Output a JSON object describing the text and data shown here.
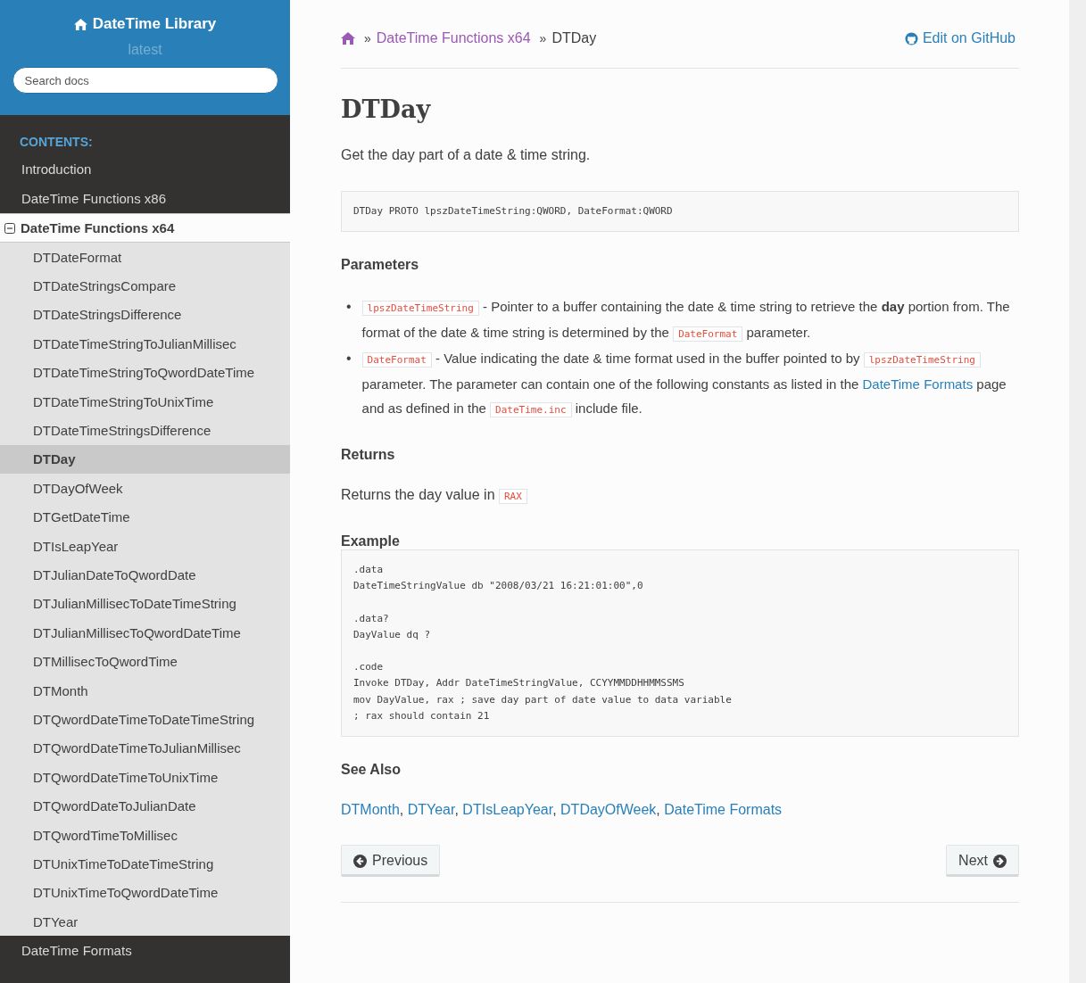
{
  "sidebar": {
    "title": "DateTime Library",
    "version": "latest",
    "search": {
      "placeholder": "Search docs"
    },
    "caption": "CONTENTS:",
    "items": [
      {
        "label": "Introduction",
        "selected": false
      },
      {
        "label": "DateTime Functions x86",
        "selected": false
      },
      {
        "label": "DateTime Functions x64",
        "selected": true,
        "expanded": true,
        "children": [
          {
            "label": "DTDateFormat",
            "selected": false
          },
          {
            "label": "DTDateStringsCompare",
            "selected": false
          },
          {
            "label": "DTDateStringsDifference",
            "selected": false
          },
          {
            "label": "DTDateTimeStringToJulianMillisec",
            "selected": false
          },
          {
            "label": "DTDateTimeStringToQwordDateTime",
            "selected": false
          },
          {
            "label": "DTDateTimeStringToUnixTime",
            "selected": false
          },
          {
            "label": "DTDateTimeStringsDifference",
            "selected": false
          },
          {
            "label": "DTDay",
            "selected": true
          },
          {
            "label": "DTDayOfWeek",
            "selected": false
          },
          {
            "label": "DTGetDateTime",
            "selected": false
          },
          {
            "label": "DTIsLeapYear",
            "selected": false
          },
          {
            "label": "DTJulianDateToQwordDate",
            "selected": false
          },
          {
            "label": "DTJulianMillisecToDateTimeString",
            "selected": false
          },
          {
            "label": "DTJulianMillisecToQwordDateTime",
            "selected": false
          },
          {
            "label": "DTMillisecToQwordTime",
            "selected": false
          },
          {
            "label": "DTMonth",
            "selected": false
          },
          {
            "label": "DTQwordDateTimeToDateTimeString",
            "selected": false
          },
          {
            "label": "DTQwordDateTimeToJulianMillisec",
            "selected": false
          },
          {
            "label": "DTQwordDateTimeToUnixTime",
            "selected": false
          },
          {
            "label": "DTQwordDateToJulianDate",
            "selected": false
          },
          {
            "label": "DTQwordTimeToMillisec",
            "selected": false
          },
          {
            "label": "DTUnixTimeToDateTimeString",
            "selected": false
          },
          {
            "label": "DTUnixTimeToQwordDateTime",
            "selected": false
          },
          {
            "label": "DTYear",
            "selected": false
          }
        ]
      },
      {
        "label": "DateTime Formats",
        "selected": false
      }
    ]
  },
  "breadcrumb": [
    {
      "kind": "home"
    },
    {
      "kind": "link",
      "sep": "»",
      "label": "DateTime Functions x64"
    },
    {
      "kind": "current",
      "sep": "»",
      "label": "DTDay"
    }
  ],
  "edit_link": "Edit on GitHub",
  "title": "DTDay",
  "intro": "Get the day part of a date & time string.",
  "signature": "DTDay PROTO lpszDateTimeString:QWORD, DateFormat:QWORD",
  "sections": [
    {
      "kind": "bullets",
      "heading": "Parameters",
      "items": [
        {
          "marker": "•",
          "segments": [
            {
              "kind": "code",
              "text": "lpszDateTimeString"
            },
            {
              "kind": "text",
              "text": " - Pointer to a buffer containing the date & time string to retrieve the **day** portion from. The format of the date & time string is determined by the "
            },
            {
              "kind": "code",
              "text": "DateFormat"
            },
            {
              "kind": "text",
              "text": " parameter."
            }
          ]
        },
        {
          "marker": "•",
          "segments": [
            {
              "kind": "code",
              "text": "DateFormat"
            },
            {
              "kind": "text",
              "text": " - Value indicating the date & time format used in the buffer pointed to by "
            },
            {
              "kind": "code",
              "text": "lpszDateTimeString"
            },
            {
              "kind": "text",
              "text": " parameter. The parameter can contain one of the following constants as listed in the "
            },
            {
              "kind": "link",
              "text": "DateTime Formats"
            },
            {
              "kind": "text",
              "text": " page and as defined in the "
            },
            {
              "kind": "code",
              "text": "DateTime.inc"
            },
            {
              "kind": "text",
              "text": " include file."
            }
          ]
        }
      ]
    },
    {
      "kind": "paragraph",
      "heading": "Returns",
      "segments": [
        {
          "kind": "text",
          "text": "Returns the day value in "
        },
        {
          "kind": "code",
          "text": "RAX"
        }
      ]
    },
    {
      "kind": "code",
      "heading": "Example",
      "blocks": [
        [
          ".data",
          "DateTimeStringValue db \"2008/03/21 16:21:01:00\",0"
        ],
        [
          ".data?",
          "DayValue dq ?"
        ],
        [
          ".code",
          "Invoke DTDay, Addr DateTimeStringValue, CCYYMMDDHHMMSSMS",
          "mov DayValue, rax ; save day part of date value to data variable",
          "; rax should contain 21"
        ]
      ]
    },
    {
      "kind": "paragraph",
      "heading": "See Also",
      "segments": [
        {
          "kind": "link",
          "text": "DTMonth"
        },
        {
          "kind": "text",
          "text": ", "
        },
        {
          "kind": "link",
          "text": "DTYear"
        },
        {
          "kind": "text",
          "text": ", "
        },
        {
          "kind": "link",
          "text": "DTIsLeapYear"
        },
        {
          "kind": "text",
          "text": ", "
        },
        {
          "kind": "link",
          "text": "DTDayOfWeek"
        },
        {
          "kind": "text",
          "text": ", "
        },
        {
          "kind": "link",
          "text": "DateTime Formats"
        }
      ]
    }
  ],
  "nav": {
    "previous": "Previous",
    "next": "Next"
  }
}
